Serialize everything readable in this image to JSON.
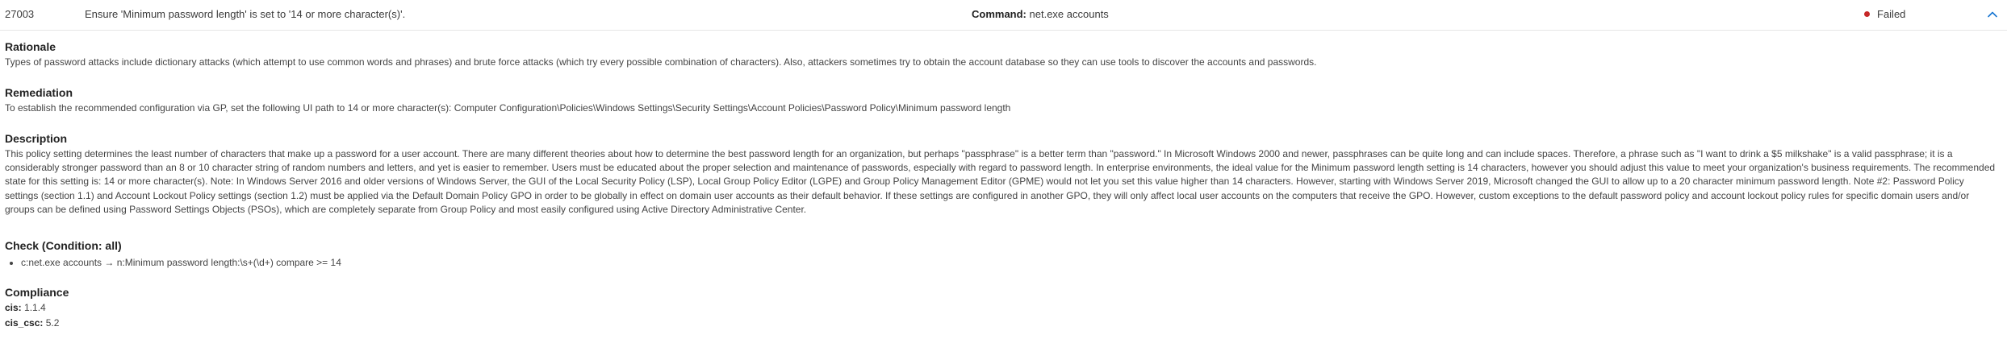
{
  "header": {
    "id": "27003",
    "title": "Ensure 'Minimum password length' is set to '14 or more character(s)'.",
    "command_label": "Command:",
    "command_value": "net.exe accounts",
    "status": "Failed",
    "status_color": "#c62828",
    "collapse_icon": "chevron-up-icon"
  },
  "rationale": {
    "title": "Rationale",
    "text": "Types of password attacks include dictionary attacks (which attempt to use common words and phrases) and brute force attacks (which try every possible combination of characters). Also, attackers sometimes try to obtain the account database so they can use tools to discover the accounts and passwords."
  },
  "remediation": {
    "title": "Remediation",
    "text": "To establish the recommended configuration via GP, set the following UI path to 14 or more character(s): Computer Configuration\\Policies\\Windows Settings\\Security Settings\\Account Policies\\Password Policy\\Minimum password length"
  },
  "description": {
    "title": "Description",
    "text": "This policy setting determines the least number of characters that make up a password for a user account. There are many different theories about how to determine the best password length for an organization, but perhaps \"passphrase\" is a better term than \"password.\" In Microsoft Windows 2000 and newer, passphrases can be quite long and can include spaces. Therefore, a phrase such as \"I want to drink a $5 milkshake\" is a valid passphrase; it is a considerably stronger password than an 8 or 10 character string of random numbers and letters, and yet is easier to remember. Users must be educated about the proper selection and maintenance of passwords, especially with regard to password length. In enterprise environments, the ideal value for the Minimum password length setting is 14 characters, however you should adjust this value to meet your organization's business requirements. The recommended state for this setting is: 14 or more character(s). Note: In Windows Server 2016 and older versions of Windows Server, the GUI of the Local Security Policy (LSP), Local Group Policy Editor (LGPE) and Group Policy Management Editor (GPME) would not let you set this value higher than 14 characters. However, starting with Windows Server 2019, Microsoft changed the GUI to allow up to a 20 character minimum password length. Note #2: Password Policy settings (section 1.1) and Account Lockout Policy settings (section 1.2) must be applied via the Default Domain Policy GPO in order to be globally in effect on domain user accounts as their default behavior. If these settings are configured in another GPO, they will only affect local user accounts on the computers that receive the GPO. However, custom exceptions to the default password policy and account lockout policy rules for specific domain users and/or groups can be defined using Password Settings Objects (PSOs), which are completely separate from Group Policy and most easily configured using Active Directory Administrative Center."
  },
  "check": {
    "title": "Check (Condition: all)",
    "items": [
      "c:net.exe accounts -> n:Minimum password length:\\s+(\\d+) compare >= 14"
    ]
  },
  "compliance": {
    "title": "Compliance",
    "entries": [
      {
        "key": "cis:",
        "value": "1.1.4"
      },
      {
        "key": "cis_csc:",
        "value": "5.2"
      }
    ]
  }
}
